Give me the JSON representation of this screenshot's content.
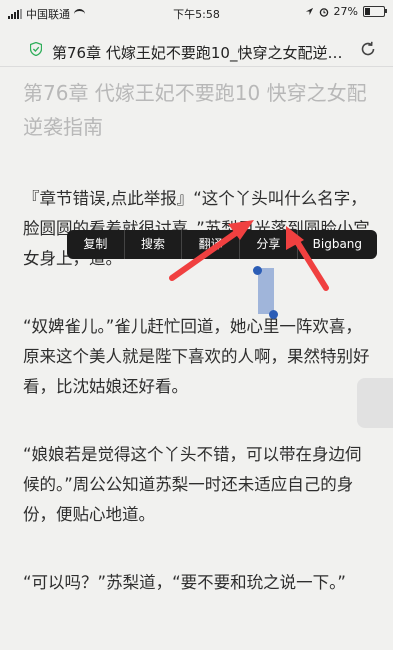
{
  "status_bar": {
    "carrier": "中国联通",
    "time": "下午5:58",
    "battery": "27%",
    "battery_level": 0.27
  },
  "title_bar": {
    "title": "第76章 代嫁王妃不要跑10_快穿之女配逆袭..."
  },
  "content": {
    "chapter_title": "第76章 代嫁王妃不要跑10 快穿之女配逆袭指南",
    "paragraphs": [
      "『章节错误,点此举报』“这个丫头叫什么名字，脸圆圆的看着就很讨喜。”苏梨目光落到圆脸小宫女身上，道。",
      "“奴婢雀儿。”雀儿赶忙回道，她心里一阵欢喜，原来这个美人就是陛下喜欢的人啊，果然特别好看，比沈姑娘还好看。",
      "“娘娘若是觉得这个丫头不错，可以带在身边伺候的。”周公公知道苏梨一时还未适应自己的身份，便贴心地道。",
      "“可以吗？”苏梨道，“要不要和玧之说一下。”"
    ]
  },
  "context_menu": {
    "items": [
      "复制",
      "搜索",
      "翻译",
      "分享",
      "Bigbang"
    ]
  },
  "colors": {
    "arrow": "#f04040",
    "selection": "#5c84c8",
    "menu_bg": "#1c1c1c"
  }
}
